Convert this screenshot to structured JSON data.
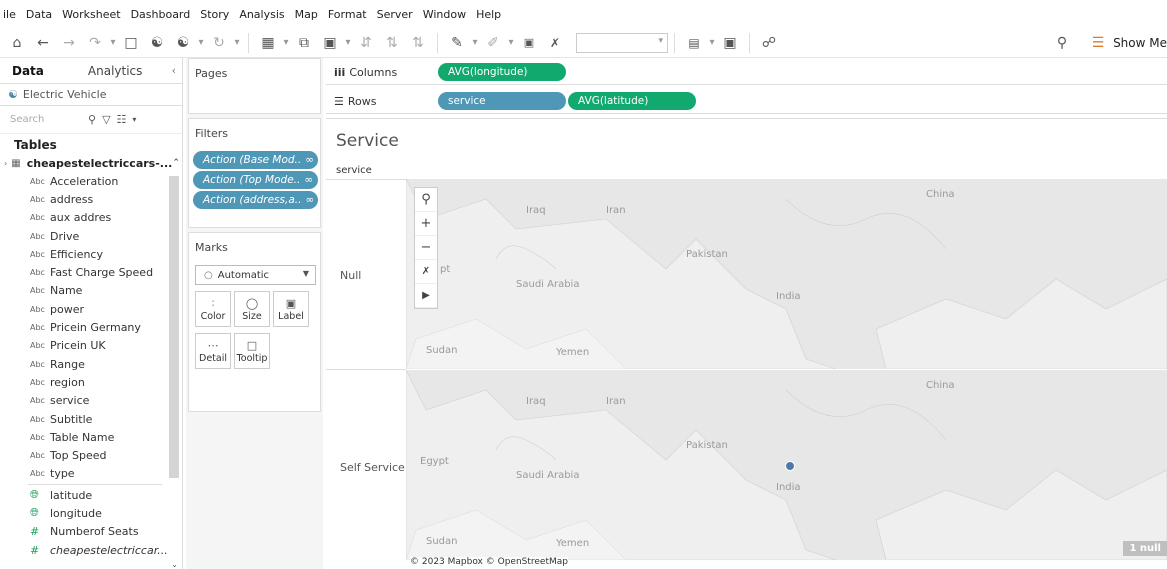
{
  "menu": [
    "ile",
    "Data",
    "Worksheet",
    "Dashboard",
    "Story",
    "Analysis",
    "Map",
    "Format",
    "Server",
    "Window",
    "Help"
  ],
  "toolbar": {
    "show_me_label": "Show Me"
  },
  "data_pane": {
    "tab_data": "Data",
    "tab_analytics": "Analytics",
    "source_name": "Electric Vehicle",
    "search_placeholder": "Search",
    "tables_label": "Tables",
    "table_name": "cheapestelectriccars-...",
    "fields": [
      {
        "type": "Abc",
        "name": "Acceleration"
      },
      {
        "type": "Abc",
        "name": "address"
      },
      {
        "type": "Abc",
        "name": "aux addres"
      },
      {
        "type": "Abc",
        "name": "Drive"
      },
      {
        "type": "Abc",
        "name": "Efficiency"
      },
      {
        "type": "Abc",
        "name": "Fast Charge Speed"
      },
      {
        "type": "Abc",
        "name": "Name"
      },
      {
        "type": "Abc",
        "name": "power"
      },
      {
        "type": "Abc",
        "name": "Pricein Germany"
      },
      {
        "type": "Abc",
        "name": "Pricein UK"
      },
      {
        "type": "Abc",
        "name": "Range"
      },
      {
        "type": "Abc",
        "name": "region"
      },
      {
        "type": "Abc",
        "name": "service"
      },
      {
        "type": "Abc",
        "name": "Subtitle"
      },
      {
        "type": "Abc",
        "name": "Table Name"
      },
      {
        "type": "Abc",
        "name": "Top Speed"
      },
      {
        "type": "Abc",
        "name": "type"
      }
    ],
    "measures": [
      {
        "type": "geo",
        "name": "latitude"
      },
      {
        "type": "geo",
        "name": "longitude"
      },
      {
        "type": "num",
        "name": "Numberof Seats"
      },
      {
        "type": "num",
        "name": "cheapestelectriccar..."
      }
    ]
  },
  "pages": {
    "title": "Pages"
  },
  "filters": {
    "title": "Filters",
    "items": [
      "Action (Base Mod..",
      "Action (Top Mode..",
      "Action (address,a.."
    ]
  },
  "marks": {
    "title": "Marks",
    "type": "Automatic",
    "buttons": [
      "Color",
      "Size",
      "Label",
      "Detail",
      "Tooltip"
    ]
  },
  "shelves": {
    "columns_label": "Columns",
    "rows_label": "Rows",
    "columns_pill": "AVG(longitude)",
    "rows_pills": [
      "service",
      "AVG(latitude)"
    ]
  },
  "view": {
    "title": "Service",
    "row_header": "service",
    "rows": [
      "Null",
      "Self Service"
    ],
    "map_labels": {
      "china": "China",
      "iraq": "Iraq",
      "iran": "Iran",
      "pakistan": "Pakistan",
      "saudi": "Saudi Arabia",
      "india": "India",
      "egypt": "Egypt",
      "sudan": "Sudan",
      "yemen": "Yemen",
      "pt": "pt"
    },
    "attribution": "© 2023 Mapbox © OpenStreetMap",
    "null_indicator": "1 null",
    "point_color": "#4e79a7"
  }
}
